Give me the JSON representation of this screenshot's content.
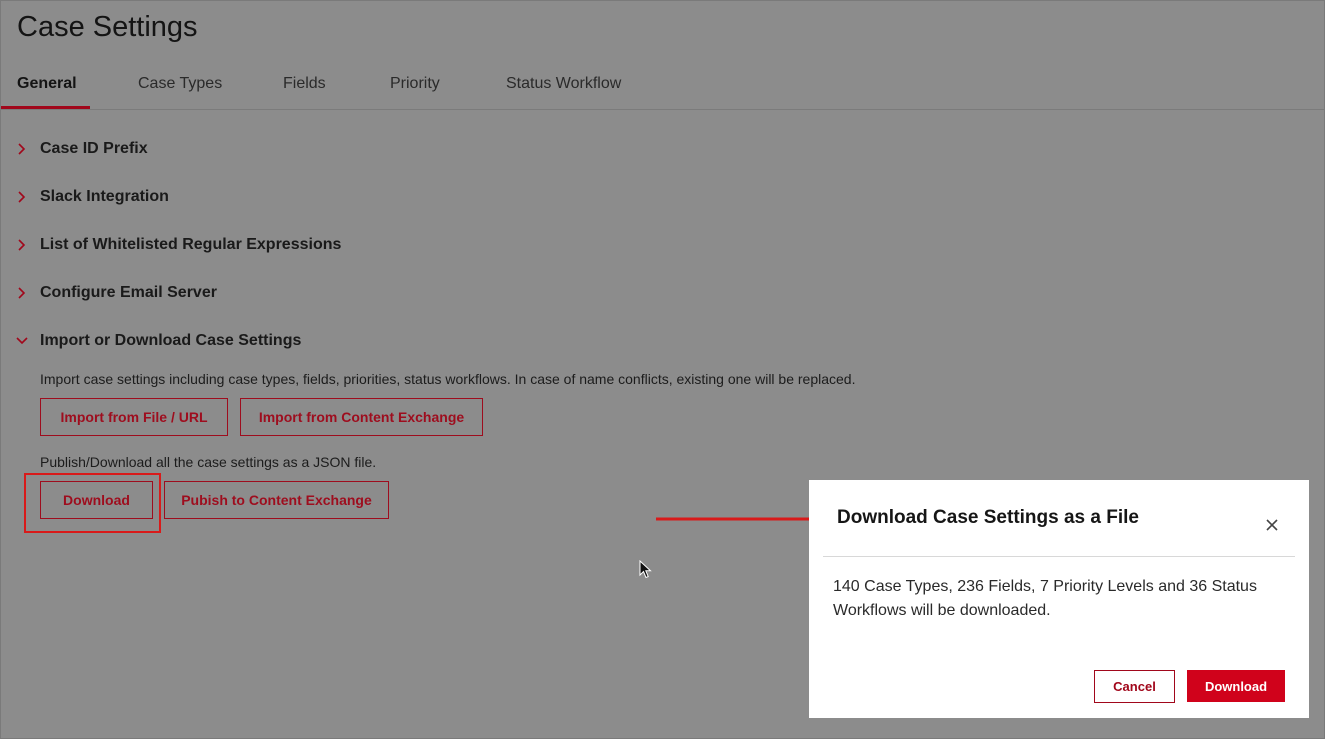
{
  "page": {
    "title": "Case Settings"
  },
  "tabs": [
    {
      "label": "General",
      "active": true
    },
    {
      "label": "Case Types"
    },
    {
      "label": "Fields"
    },
    {
      "label": "Priority"
    },
    {
      "label": "Status Workflow"
    }
  ],
  "sections": [
    {
      "title": "Case ID Prefix",
      "expanded": false
    },
    {
      "title": "Slack Integration",
      "expanded": false
    },
    {
      "title": "List of Whitelisted Regular Expressions",
      "expanded": false
    },
    {
      "title": "Configure Email Server",
      "expanded": false
    },
    {
      "title": "Import or Download Case Settings",
      "expanded": true
    }
  ],
  "import_section": {
    "import_description": "Import case settings including case types, fields, priorities, status workflows. In case of name conflicts, existing one will be replaced.",
    "import_file_label": "Import from File / URL",
    "import_exchange_label": "Import from Content Exchange",
    "download_description": "Publish/Download all the case settings as a JSON file.",
    "download_label": "Download",
    "publish_label": "Pubish to Content Exchange"
  },
  "modal": {
    "title": "Download Case Settings as a File",
    "close_label": "X",
    "body": "140 Case Types, 236 Fields, 7 Priority Levels and 36 Status Workflows will be downloaded.",
    "cancel_label": "Cancel",
    "download_label": "Download"
  },
  "colors": {
    "background_overlay": "#8c8c8c",
    "accent": "#a1071b",
    "primary_button": "#d0021b",
    "annotation": "#d91a1a"
  },
  "icons": {
    "collapsed": "chevron-right-icon",
    "expanded": "chevron-down-icon",
    "close": "close-icon",
    "annotation_arrow": "arrow-right-icon",
    "cursor": "mouse-pointer-icon"
  }
}
